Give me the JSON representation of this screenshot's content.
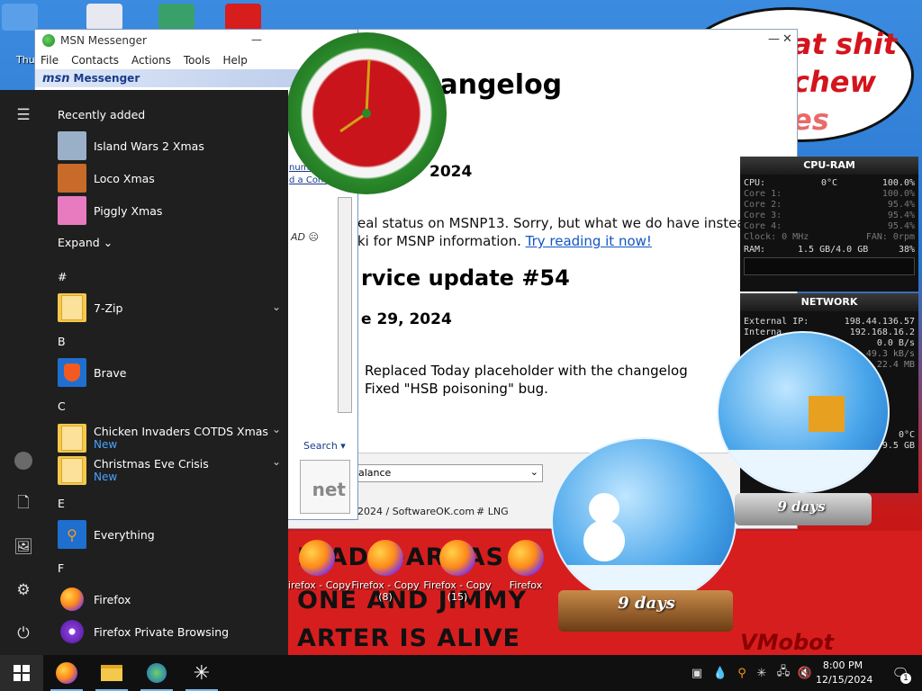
{
  "colors": {
    "taskbar": "#101010",
    "start_menu": "#1f1f1f",
    "accent_link": "#1056c2",
    "new_badge": "#4aa3ff",
    "banner_red": "#d71e1e"
  },
  "desktop": {
    "speech_lines": [
      "at shit",
      "chew",
      "es"
    ],
    "banner_lines": [
      "HIAD L-ARGAS",
      "ONE AND JIMMY",
      "ARTER IS ALIVE"
    ],
    "vmobot": "VMobot",
    "top_icon_label": "Thu",
    "shortcuts": [
      {
        "label": "Firefox - Copy",
        "icon": "firefox-icon"
      },
      {
        "label": "Firefox - Copy (8)",
        "icon": "firefox-icon"
      },
      {
        "label": "Firefox - Copy (15)",
        "icon": "firefox-icon"
      },
      {
        "label": "Firefox",
        "icon": "firefox-icon"
      }
    ]
  },
  "changelog": {
    "heading": "hangelog",
    "date1": "2024",
    "para_line1": "eal status on MSNP13. Sorry, but what we do have instead is",
    "para_line2_pre": "ki for MSNP information. ",
    "para_link": "Try reading it now!",
    "service_update": "rvice update #54",
    "date2": "e 29, 2024",
    "items": [
      "Replaced Today placeholder with the changelog",
      "Fixed \"HSB poisoning\" bug."
    ],
    "select_value": "alance",
    "copyright": "2024 / SoftwareOK.com",
    "lng": "# LNG"
  },
  "msn": {
    "title": "MSN Messenger",
    "menu": [
      "File",
      "Contacts",
      "Actions",
      "Tools",
      "Help"
    ],
    "brand_logo": "msn",
    "brand_name": "Messenger",
    "link1": "number",
    "link2": "d a Cont",
    "status": "AD",
    "search": "Search",
    "ad_text": "net"
  },
  "start_menu": {
    "recently_added_label": "Recently added",
    "recent": [
      {
        "name": "Island Wars 2 Xmas",
        "icon": "island-wars-icon"
      },
      {
        "name": "Loco Xmas",
        "icon": "loco-icon"
      },
      {
        "name": "Piggly Xmas",
        "icon": "piggly-icon"
      }
    ],
    "expand_label": "Expand",
    "groups": [
      {
        "letter": "#",
        "apps": [
          {
            "name": "7-Zip",
            "sub": "",
            "icon": "folder-icon",
            "chevron": true
          }
        ]
      },
      {
        "letter": "B",
        "apps": [
          {
            "name": "Brave",
            "sub": "",
            "icon": "brave-icon",
            "chevron": false
          }
        ]
      },
      {
        "letter": "C",
        "apps": [
          {
            "name": "Chicken Invaders COTDS Xmas",
            "sub": "New",
            "icon": "folder-icon",
            "chevron": true
          },
          {
            "name": "Christmas Eve Crisis",
            "sub": "New",
            "icon": "folder-icon",
            "chevron": true
          }
        ]
      },
      {
        "letter": "E",
        "apps": [
          {
            "name": "Everything",
            "sub": "",
            "icon": "everything-icon",
            "chevron": false
          }
        ]
      },
      {
        "letter": "F",
        "apps": [
          {
            "name": "Firefox",
            "sub": "",
            "icon": "firefox-icon",
            "chevron": false
          },
          {
            "name": "Firefox Private Browsing",
            "sub": "",
            "icon": "firefox-private-icon",
            "chevron": false
          }
        ]
      }
    ]
  },
  "cpu_ram": {
    "title": "CPU-RAM",
    "cpu_label": "CPU:",
    "cpu_temp": "0°C",
    "cpu_pct": "100.0%",
    "cores": [
      {
        "label": "Core 1:",
        "value": "100.0%"
      },
      {
        "label": "Core 2:",
        "value": "95.4%"
      },
      {
        "label": "Core 3:",
        "value": "95.4%"
      },
      {
        "label": "Core 4:",
        "value": "95.4%"
      }
    ],
    "clock": "Clock: 0 MHz",
    "fan": "FAN: 0rpm",
    "ram_label": "RAM:",
    "ram_value": "1.5 GB/4.0 GB",
    "ram_pct": "38%"
  },
  "network": {
    "title": "NETWORK",
    "external_label": "External IP:",
    "external_ip": "198.44.136.57",
    "internal_label": "Interna",
    "internal_ip": "192.168.16.2",
    "rate1": "0.0 B/s",
    "rate2": "49.3 kB/s",
    "size": "22.4 MB",
    "temp": "0°C",
    "disk": "9.5 GB"
  },
  "globes": {
    "left_label": "9 days",
    "right_label": "9 days"
  },
  "taskbar": {
    "apps": [
      "firefox-icon",
      "file-explorer-icon",
      "msn-icon",
      "sparkle-icon"
    ],
    "tray": [
      "tray-app-icon",
      "droplet-icon",
      "search-tray-icon",
      "sparkle-tray-icon",
      "network-icon",
      "volume-muted-icon"
    ],
    "time": "8:00 PM",
    "date": "12/15/2024",
    "notifications": "1"
  }
}
